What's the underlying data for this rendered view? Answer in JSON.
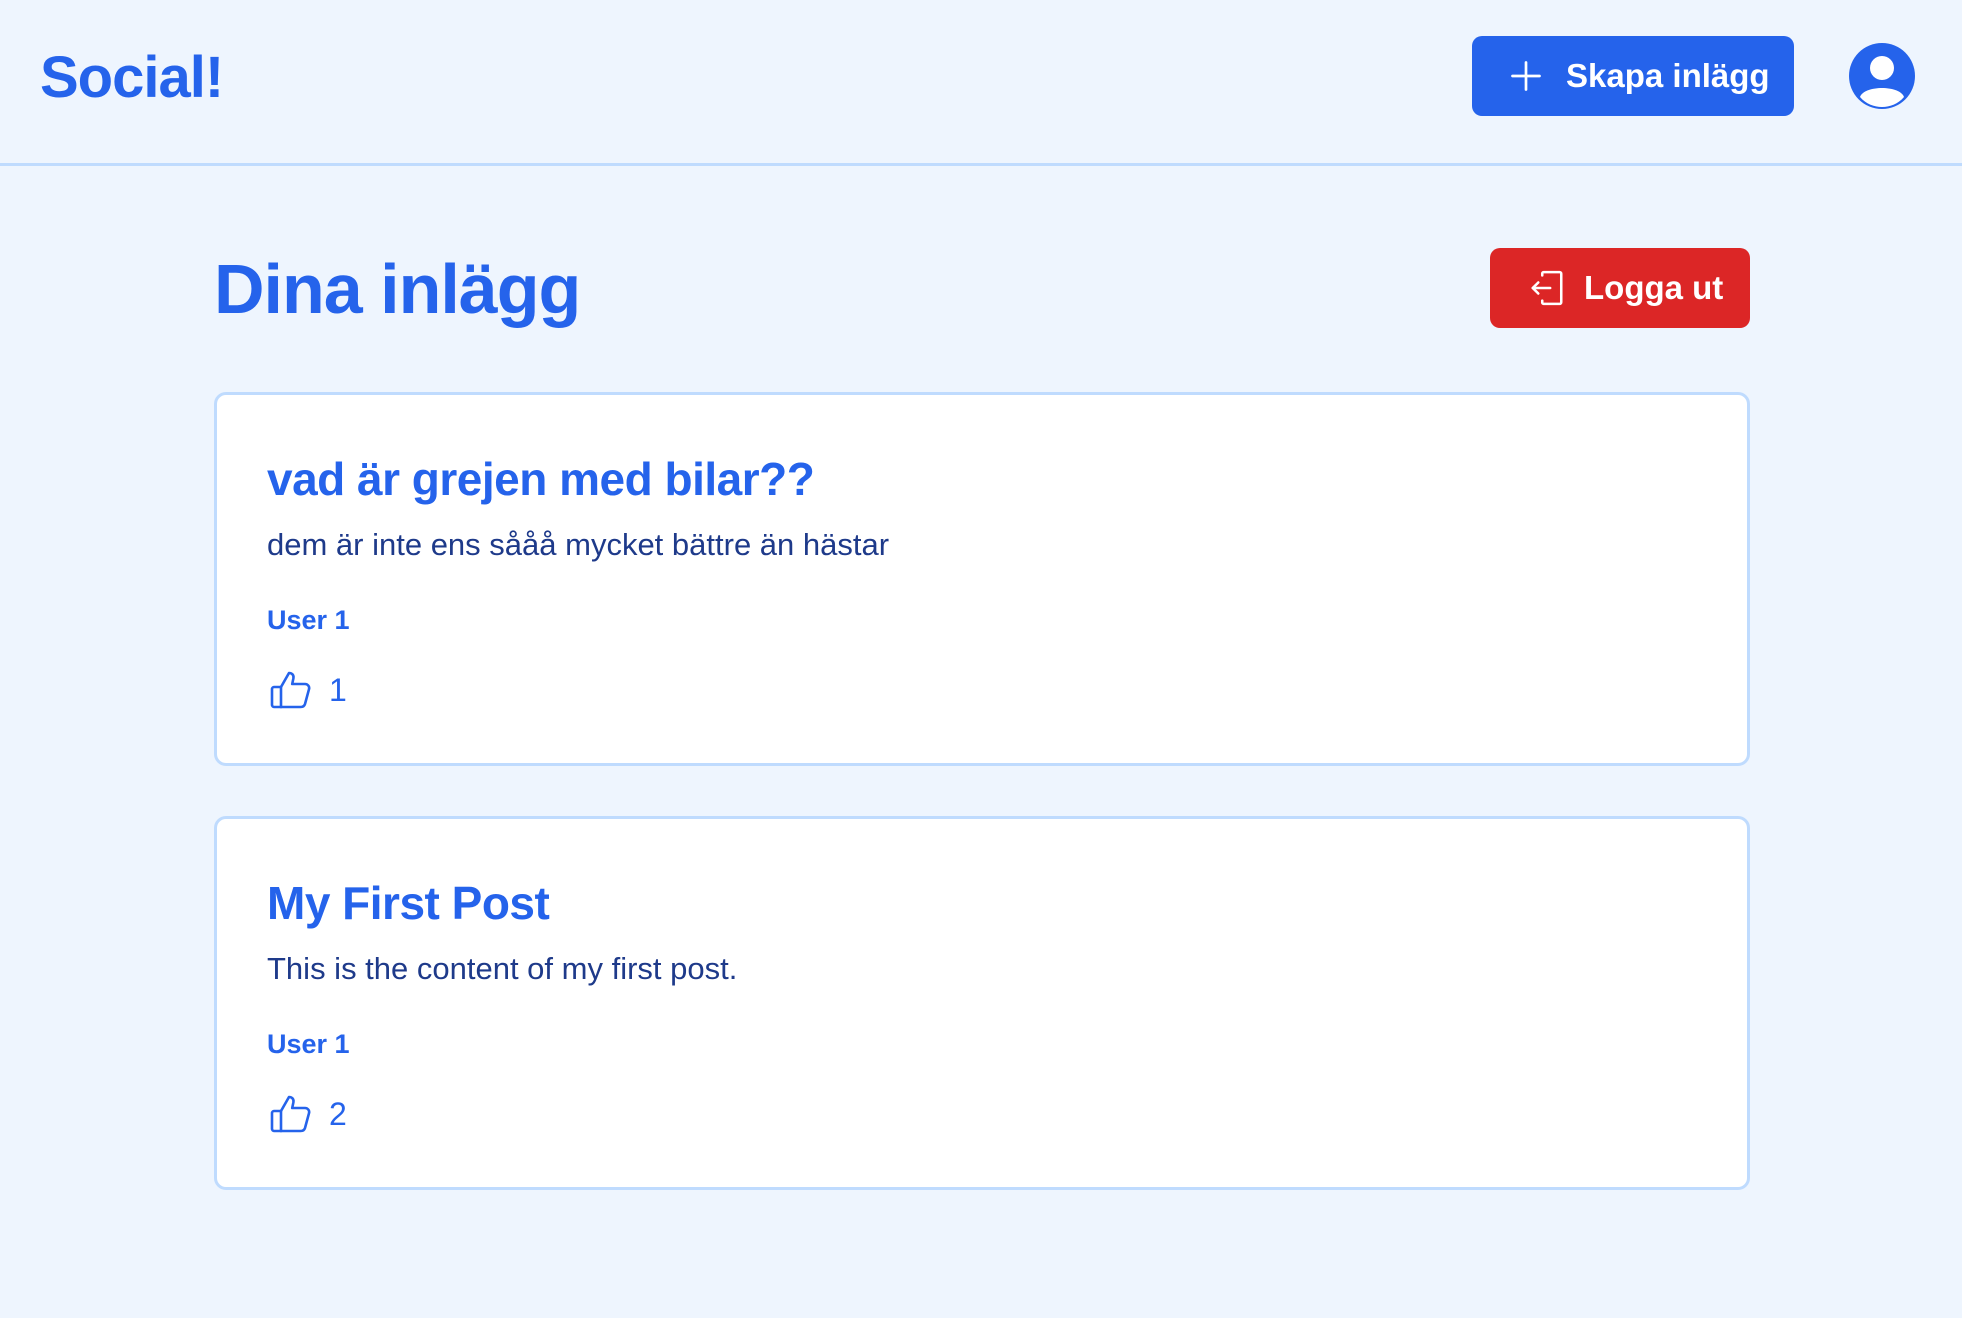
{
  "header": {
    "logo": "Social!",
    "create_post_label": "Skapa inlägg"
  },
  "main": {
    "title": "Dina inlägg",
    "logout_label": "Logga ut"
  },
  "posts": [
    {
      "title": "vad är grejen med bilar??",
      "content": "dem är inte ens sååå mycket bättre än hästar",
      "author": "User 1",
      "likes": "1"
    },
    {
      "title": "My First Post",
      "content": "This is the content of my first post.",
      "author": "User 1",
      "likes": "2"
    }
  ],
  "colors": {
    "background": "#eef5fe",
    "primary": "#2563eb",
    "danger": "#dc2626",
    "border": "#bfdbfe",
    "card": "#ffffff",
    "text_dark": "#1e3a8a"
  },
  "icons": {
    "create": "plus-icon",
    "profile": "user-circle-icon",
    "logout": "logout-icon",
    "like": "thumbs-up-icon"
  }
}
